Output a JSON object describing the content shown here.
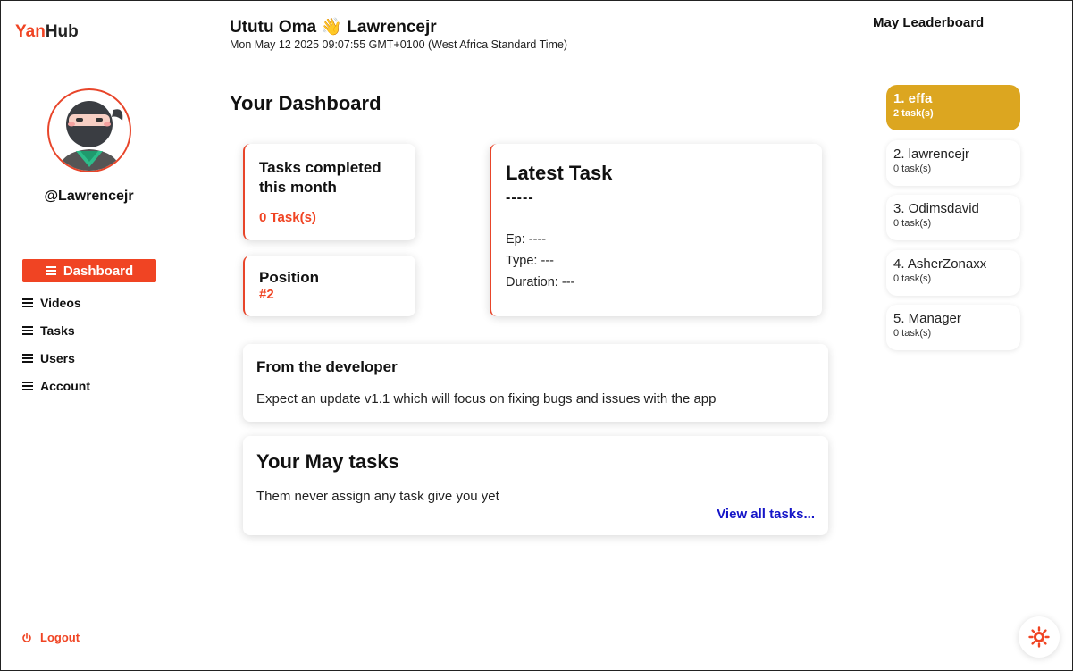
{
  "brand": {
    "part1": "Yan",
    "part2": "Hub"
  },
  "profile": {
    "username": "@Lawrencejr"
  },
  "nav": [
    {
      "label": "Dashboard",
      "active": true
    },
    {
      "label": "Videos"
    },
    {
      "label": "Tasks"
    },
    {
      "label": "Users"
    },
    {
      "label": "Account"
    }
  ],
  "logout": {
    "label": "Logout"
  },
  "header": {
    "greeting": "Ututu Oma 👋 Lawrencejr",
    "datetime": "Mon May 12 2025 09:07:55 GMT+0100 (West Africa Standard Time)"
  },
  "dashboard": {
    "title": "Your Dashboard",
    "tasks_card": {
      "title": "Tasks completed this month",
      "value": "0 Task(s)"
    },
    "position_card": {
      "title": "Position",
      "value": "#2"
    },
    "latest_task": {
      "title": "Latest Task",
      "name": "-----",
      "ep": "Ep: ----",
      "type": "Type: ---",
      "duration": "Duration: ---"
    },
    "developer": {
      "title": "From the developer",
      "message": "Expect an update v1.1 which will focus on fixing bugs and issues with the app"
    },
    "may_tasks": {
      "title": "Your May tasks",
      "message": "Them never assign any task give you yet",
      "link": "View all tasks..."
    }
  },
  "leaderboard": {
    "title": "May Leaderboard",
    "entries": [
      {
        "name": "1. effa",
        "count": "2 task(s)"
      },
      {
        "name": "2. lawrencejr",
        "count": "0 task(s)"
      },
      {
        "name": "3. Odimsdavid",
        "count": "0 task(s)"
      },
      {
        "name": "4. AsherZonaxx",
        "count": "0 task(s)"
      },
      {
        "name": "5. Manager",
        "count": "0 task(s)"
      }
    ]
  },
  "colors": {
    "accent": "#f04423",
    "gold": "#dca620",
    "link": "#1515c8"
  },
  "icons": {
    "menu": "hamburger-icon",
    "logout": "power-icon",
    "theme": "sun-icon"
  }
}
